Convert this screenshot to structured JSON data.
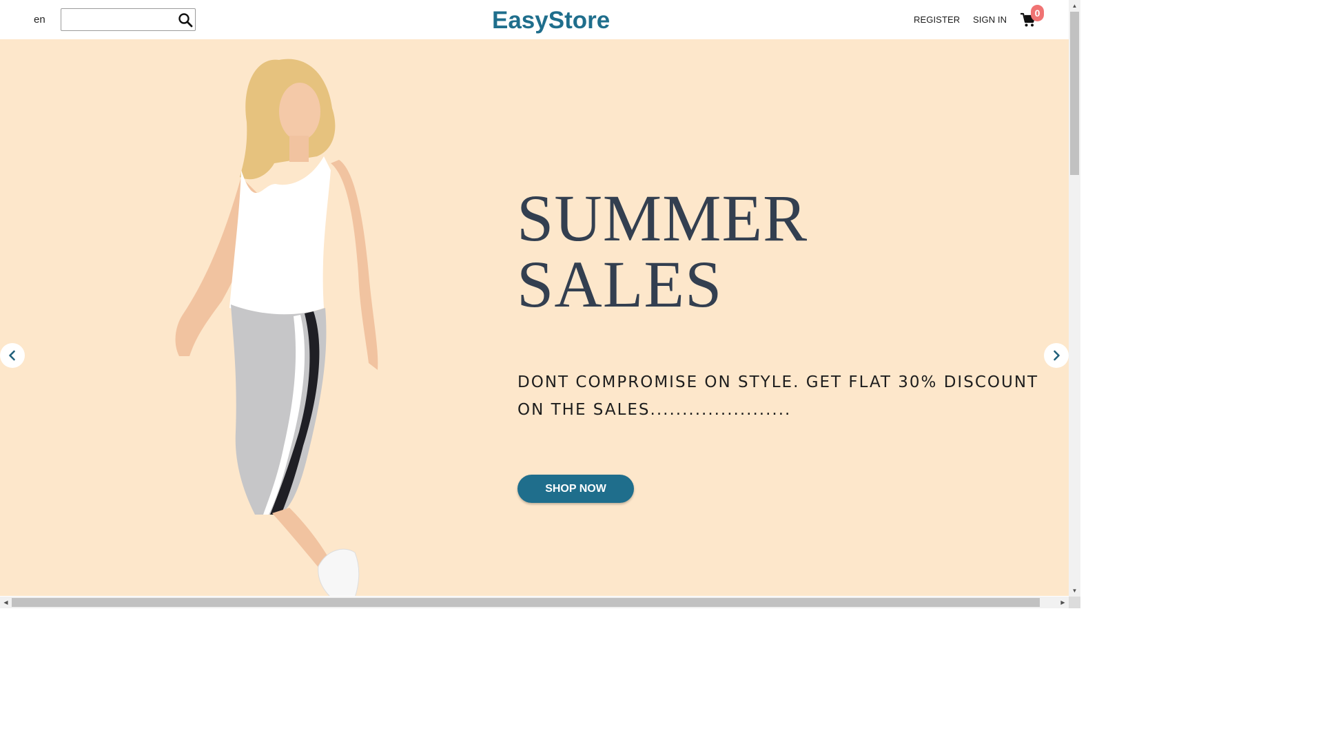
{
  "header": {
    "language": "en",
    "search": {
      "value": "",
      "placeholder": ""
    },
    "logo_text": "EasyStore",
    "register_label": "REGISTER",
    "signin_label": "SIGN IN",
    "cart_count": "0",
    "icons": {
      "search": "search-icon",
      "cart": "cart-icon"
    }
  },
  "hero": {
    "headline_line1": "SUMMER",
    "headline_line2": "SALES",
    "subtext": "DONT COMPROMISE ON STYLE. GET FLAT 30% DISCOUNT ON THE SALES......................",
    "cta_label": "SHOP NOW",
    "background_color": "#fde7cb",
    "icons": {
      "prev": "chevron-left-icon",
      "next": "chevron-right-icon"
    }
  },
  "colors": {
    "brand": "#1f6e8c",
    "headline": "#333f50",
    "badge": "#f07373"
  }
}
